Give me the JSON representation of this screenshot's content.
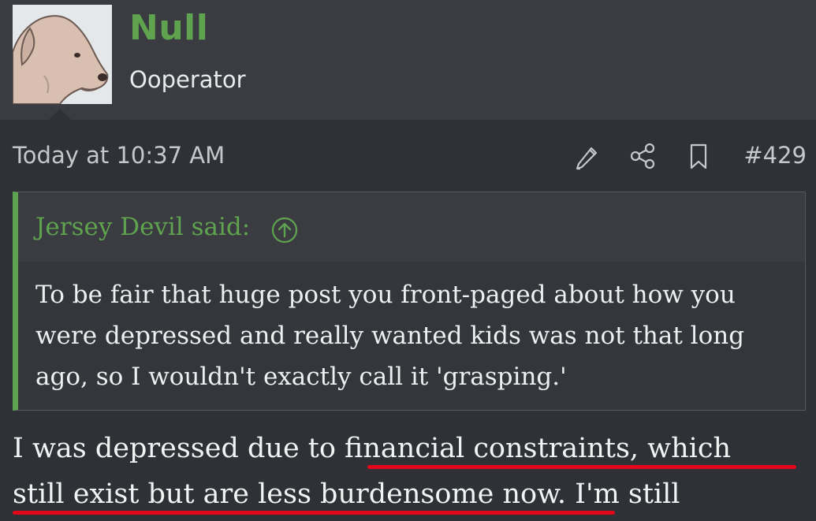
{
  "user": {
    "name": "Null",
    "title": "Ooperator",
    "avatar_icon": "dog-avatar"
  },
  "post": {
    "timestamp": "Today at 10:37 AM",
    "number": "#429",
    "actions": [
      "pencil-icon",
      "share-icon",
      "bookmark-icon"
    ]
  },
  "quote": {
    "author": "Jersey Devil said:",
    "text": "To be fair that huge post you front-paged about how you were depressed and really wanted kids was not that long ago, so I wouldn't exactly call it 'grasping.'"
  },
  "body": {
    "before": "I was depressed due to ",
    "highlight1": "financial constraints, which",
    "highlight2": "still exist but are less burdensome now.",
    "after": " I'm still"
  },
  "colors": {
    "accent": "#5fa34f",
    "background": "#2f3136",
    "header": "#3a3c41",
    "underline": "#e3071b"
  }
}
